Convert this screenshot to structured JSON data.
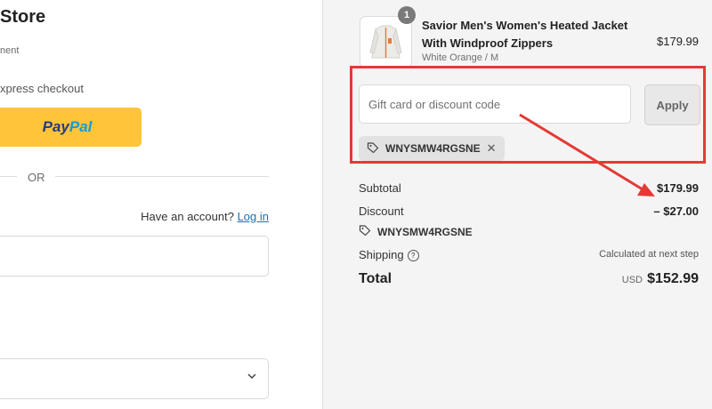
{
  "left": {
    "store_title": "Store",
    "crumb": "nent",
    "express_checkout": "xpress checkout",
    "paypal": {
      "pay": "Pay",
      "pal": "Pal"
    },
    "or": "OR",
    "have_account": "Have an account?",
    "login": "Log in"
  },
  "product": {
    "quantity": "1",
    "name": "Savior Men's Women's Heated Jacket With Windproof Zippers",
    "variant": "White Orange / M",
    "price": "$179.99"
  },
  "discount_form": {
    "placeholder": "Gift card or discount code",
    "apply": "Apply",
    "applied_code": "WNYSMW4RGSNE"
  },
  "summary": {
    "subtotal_label": "Subtotal",
    "subtotal_value": "$179.99",
    "discount_label": "Discount",
    "discount_value": "– $27.00",
    "discount_code": "WNYSMW4RGSNE",
    "shipping_label": "Shipping",
    "shipping_value": "Calculated at next step",
    "total_label": "Total",
    "total_currency": "USD",
    "total_value": "$152.99"
  },
  "colors": {
    "annotation": "#e53935",
    "paypal_yellow": "#ffc439",
    "link": "#1773b0"
  }
}
